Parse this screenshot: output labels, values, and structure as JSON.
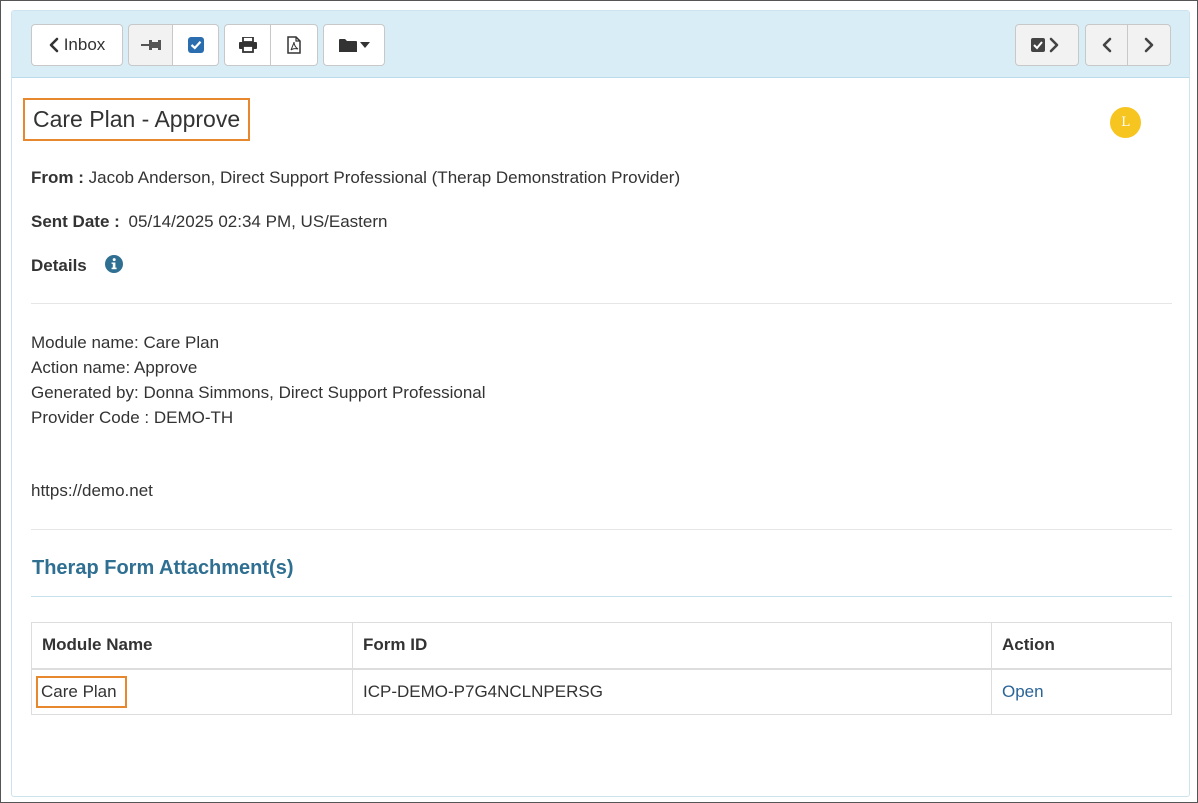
{
  "toolbar": {
    "inbox_label": "Inbox",
    "icons": [
      "chevron-left-icon",
      "pin-icon",
      "checkbox-icon",
      "print-icon",
      "pdf-icon",
      "folder-icon",
      "caret-down-icon",
      "check-next-icon",
      "chevron-left-icon",
      "chevron-right-icon"
    ]
  },
  "message": {
    "title": "Care Plan - Approve",
    "avatar_initial": "L",
    "from_label": "From :",
    "from_value": "Jacob Anderson, Direct Support Professional (Therap Demonstration Provider)",
    "sent_label": "Sent Date :",
    "sent_value": "05/14/2025 02:34 PM, US/Eastern",
    "details_label": "Details",
    "body_lines": [
      "Module name: Care Plan",
      "Action name: Approve",
      "Generated by: Donna Simmons, Direct Support Professional",
      "Provider Code : DEMO-TH"
    ],
    "url": "https://demo.net"
  },
  "attachments": {
    "title": "Therap Form Attachment(s)",
    "columns": [
      "Module Name",
      "Form ID",
      "Action"
    ],
    "rows": [
      {
        "module": "Care Plan",
        "form_id": "ICP-DEMO-P7G4NCLNPERSG",
        "action": "Open"
      }
    ]
  },
  "colors": {
    "toolbar_bg": "#d9edf7",
    "highlight": "#e8882e",
    "section_title": "#2f6f91",
    "link": "#2a6496",
    "avatar": "#f7c520"
  }
}
